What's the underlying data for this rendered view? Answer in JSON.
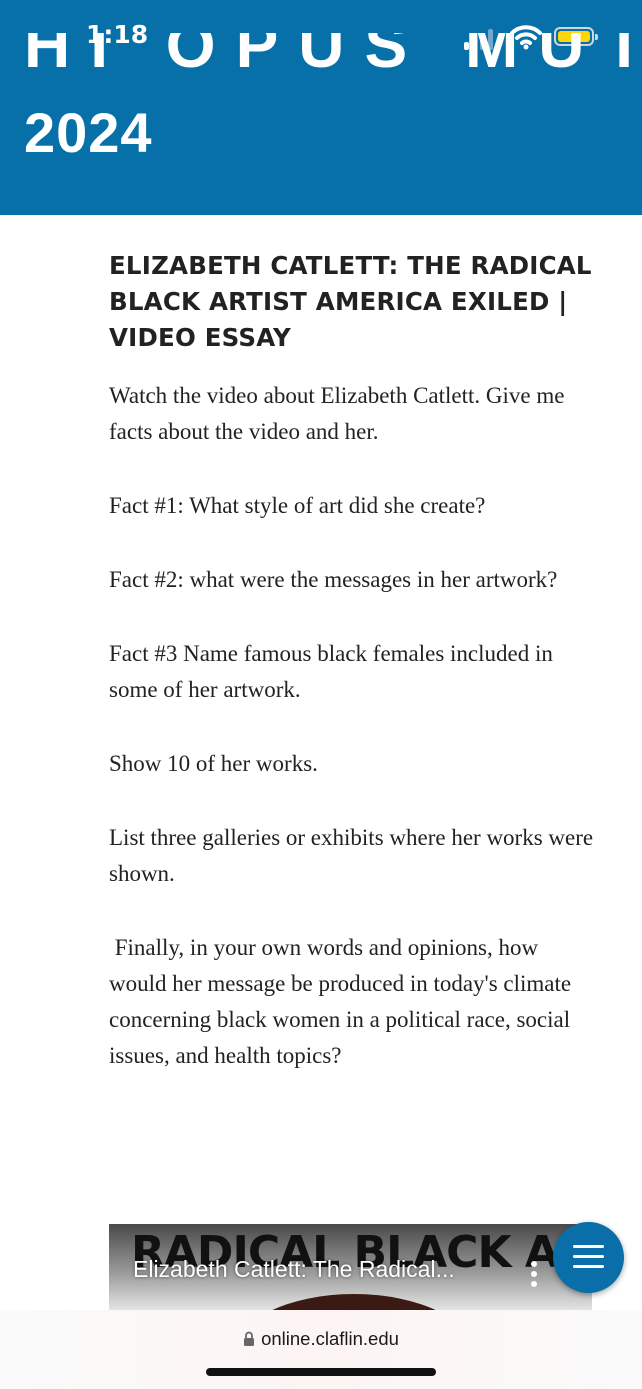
{
  "status_bar": {
    "time": "1:18",
    "signal_bars": 4,
    "battery_color": "#ffd60a"
  },
  "header": {
    "background": "#0770a8",
    "cut_heading": "HI OPUS MUTX",
    "year": "2024"
  },
  "article": {
    "title": "ELIZABETH CATLETT: THE RADICAL BLACK ARTIST AMERICA EXILED | VIDEO ESSAY",
    "paragraphs": [
      "Watch the video about Elizabeth Catlett. Give me facts about the video and her.",
      "Fact #1: What style of art did she create?",
      "Fact #2: what were the messages in her artwork?",
      "Fact #3 Name famous black females included in some of her artwork.",
      "Show 10 of her works.",
      "List three galleries or exhibits where her works were shown.",
      " Finally, in your own words and opinions, how would her message be produced in today's climate concerning black women in a political race, social issues, and health topics?"
    ]
  },
  "video": {
    "thumbnail_text": "RADICAL BLACK ART",
    "title": "Elizabeth Catlett: The Radical...",
    "menu_icon": "more-vertical-icon"
  },
  "fab": {
    "icon": "hamburger-menu-icon",
    "color": "#0a6ea8"
  },
  "browser": {
    "url": "online.claflin.edu",
    "lock_icon": "lock-icon"
  }
}
